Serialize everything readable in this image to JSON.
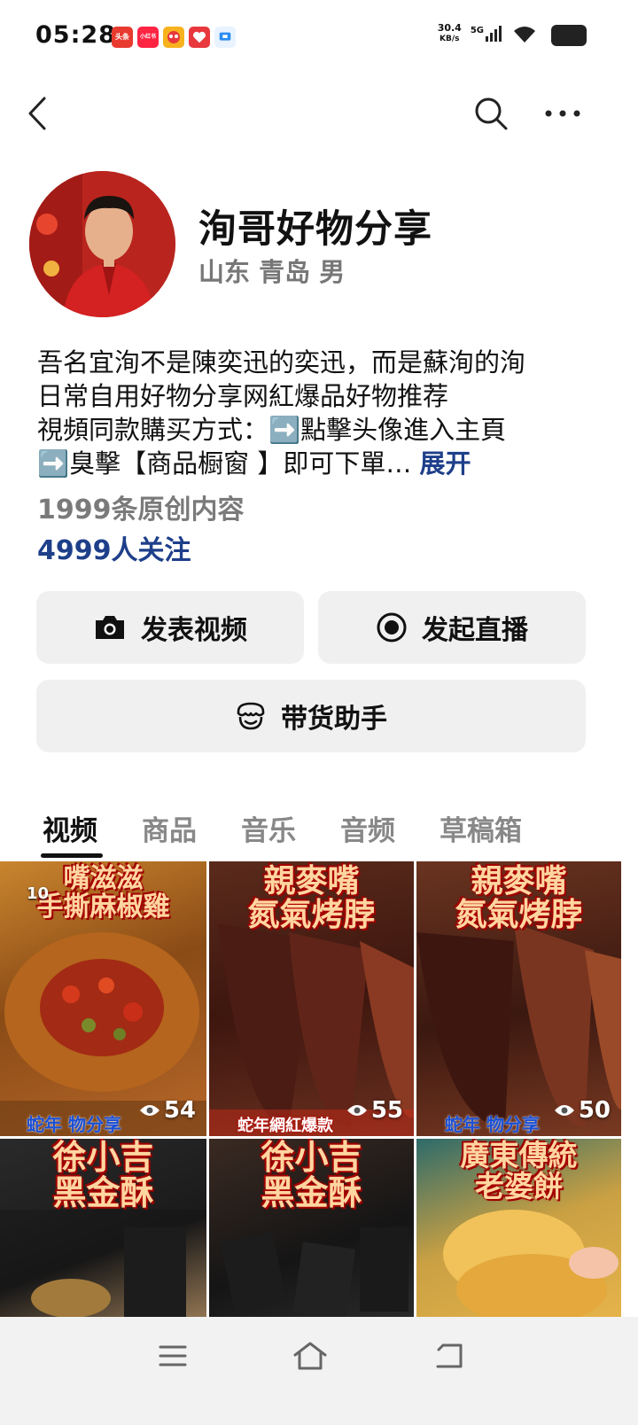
{
  "status_bar": {
    "time": "05:28",
    "net_speed_value": "30.4",
    "net_speed_unit": "KB/s",
    "network": "5G",
    "notifications": [
      {
        "icon": "toutiao-app-icon",
        "text": "头条",
        "color": "#e83a2f"
      },
      {
        "icon": "xiaohongshu-app-icon",
        "text": "小红书",
        "color": "#ff2442"
      },
      {
        "icon": "game-app-icon",
        "text": "",
        "color": "#f7b21d"
      },
      {
        "icon": "heart-app-icon",
        "text": "",
        "color": "#e8383d"
      },
      {
        "icon": "chat-app-icon",
        "text": "",
        "color": "#2a8cf2"
      }
    ]
  },
  "nav": {
    "back_icon": "back-icon",
    "search_icon": "search-icon",
    "more_icon": "more-icon"
  },
  "profile": {
    "name": "洵哥好物分享",
    "meta": "山东 青岛 男",
    "bio_lines": [
      "吾名宜洵不是陳奕迅的奕迅，而是蘇洵的洵",
      "日常自用好物分享网紅爆品好物推荐",
      "視頻同款購买方式：➡️點擊头像進入主頁",
      "➡️臭擊【商品橱窗 】即可下單…"
    ],
    "expand_label": "展开",
    "original_content": "1999条原创内容",
    "followers": "4999人关注"
  },
  "actions": {
    "post_video": "发表视频",
    "start_live": "发起直播",
    "sales_assistant": "带货助手"
  },
  "tabs": [
    {
      "label": "视频",
      "active": true
    },
    {
      "label": "商品",
      "active": false
    },
    {
      "label": "音乐",
      "active": false
    },
    {
      "label": "音频",
      "active": false
    },
    {
      "label": "草稿箱",
      "active": false
    }
  ],
  "videos": [
    {
      "caption_1": "嘴滋滋",
      "caption_2": "手撕麻椒雞",
      "views": "54",
      "badge": "10",
      "bottom_text": "蛇年 物分享"
    },
    {
      "caption_1": "親麥嘴",
      "caption_2": "氮氣烤脖",
      "views": "55",
      "bottom_text": "蛇年網紅爆款"
    },
    {
      "caption_1": "親麥嘴",
      "caption_2": "氮氣烤脖",
      "views": "50",
      "bottom_text": "蛇年 物分享"
    },
    {
      "caption_1": "徐小吉",
      "caption_2": "黑金酥"
    },
    {
      "caption_1": "徐小吉",
      "caption_2": "黑金酥"
    },
    {
      "caption_1": "廣東傳統",
      "caption_2": "老婆餅"
    }
  ]
}
